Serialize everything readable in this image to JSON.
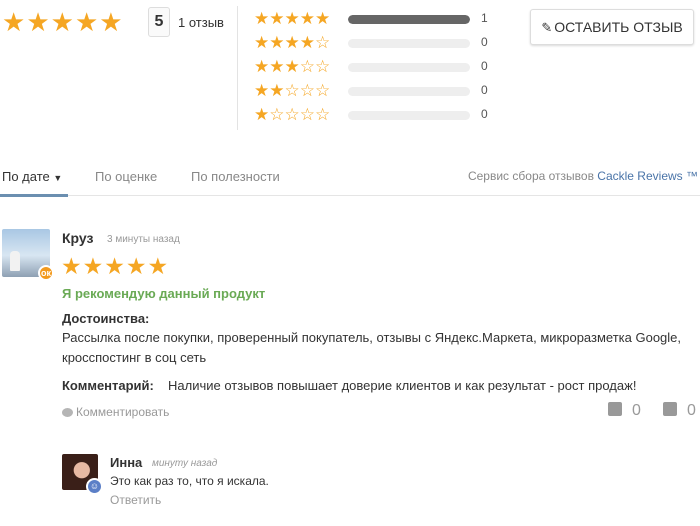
{
  "summary": {
    "rating": "5",
    "count_label": "1 отзыв",
    "stars_filled": 5,
    "distribution": [
      {
        "stars": 5,
        "count": "1",
        "fraction": 1.0
      },
      {
        "stars": 4,
        "count": "0",
        "fraction": 0
      },
      {
        "stars": 3,
        "count": "0",
        "fraction": 0
      },
      {
        "stars": 2,
        "count": "0",
        "fraction": 0
      },
      {
        "stars": 1,
        "count": "0",
        "fraction": 0
      }
    ],
    "write_review_label": "ОСТАВИТЬ ОТЗЫВ"
  },
  "tabs": [
    {
      "label": "По дате",
      "active": true
    },
    {
      "label": "По оценке",
      "active": false
    },
    {
      "label": "По полезности",
      "active": false
    }
  ],
  "service": {
    "prefix": "Сервис сбора отзывов",
    "link": "Cackle Reviews ™"
  },
  "review": {
    "author": "Круз",
    "time": "3 минуты назад",
    "stars": 5,
    "recommend": "Я рекомендую данный продукт",
    "pros_title": "Достоинства:",
    "pros_text": "Рассылка после покупки, проверенный покупатель, отзывы с Яндекс.Маркета, микроразметка Google, кросспостинг в соц сеть",
    "comment_label": "Комментарий:",
    "comment_text": "Наличие отзывов повышает доверие клиентов и как результат - рост продаж!",
    "comment_action": "Комментировать",
    "votes_down": "0",
    "votes_up": "0"
  },
  "reply": {
    "author": "Инна",
    "time": "минуту назад",
    "text": "Это как раз то, что я искала.",
    "action": "Ответить"
  },
  "colors": {
    "star": "#f5a623",
    "recommend": "#6aaa55",
    "link": "#4a74a8",
    "bar_fill": "#666666"
  },
  "icons": {
    "star": "star-icon",
    "pencil": "pencil-icon",
    "dropdown": "caret-down-icon",
    "comment": "speech-bubble-icon",
    "thumbs_down": "thumbs-down-icon",
    "thumbs_up": "thumbs-up-icon"
  }
}
